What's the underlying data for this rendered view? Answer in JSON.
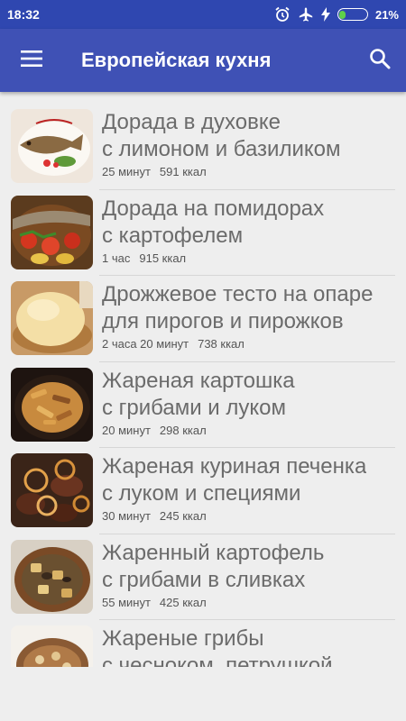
{
  "status": {
    "time": "18:32",
    "battery_pct": "21%",
    "battery_level": 0.21,
    "icons": [
      "alarm-icon",
      "airplane-icon",
      "charging-icon",
      "battery-icon"
    ]
  },
  "appbar": {
    "title": "Европейская кухня",
    "menu_icon": "hamburger-menu-icon",
    "search_icon": "search-icon"
  },
  "colors": {
    "status_bar": "#2f47b0",
    "app_bar": "#3f51b5",
    "background": "#eeeeee",
    "title_text": "#6b6b6b"
  },
  "recipes": [
    {
      "line1": "Дорада в духовке",
      "line2": "с лимоном и базиликом",
      "time": "25 минут",
      "kcal": "591 ккал"
    },
    {
      "line1": "Дорада на помидорах",
      "line2": "с картофелем",
      "time": "1 час",
      "kcal": "915 ккал"
    },
    {
      "line1": "Дрожжевое тесто на опаре",
      "line2": "для пирогов и пирожков",
      "time": "2 часа 20 минут",
      "kcal": "738 ккал"
    },
    {
      "line1": "Жареная картошка",
      "line2": "с грибами и луком",
      "time": "20 минут",
      "kcal": "298 ккал"
    },
    {
      "line1": "Жареная куриная печенка",
      "line2": "с луком и специями",
      "time": "30 минут",
      "kcal": "245 ккал"
    },
    {
      "line1": "Жаренный картофель",
      "line2": "с грибами в сливках",
      "time": "55 минут",
      "kcal": "425 ккал"
    },
    {
      "line1": "Жареные грибы",
      "line2": "с чесноком, петрушкой",
      "time": "",
      "kcal": ""
    }
  ]
}
